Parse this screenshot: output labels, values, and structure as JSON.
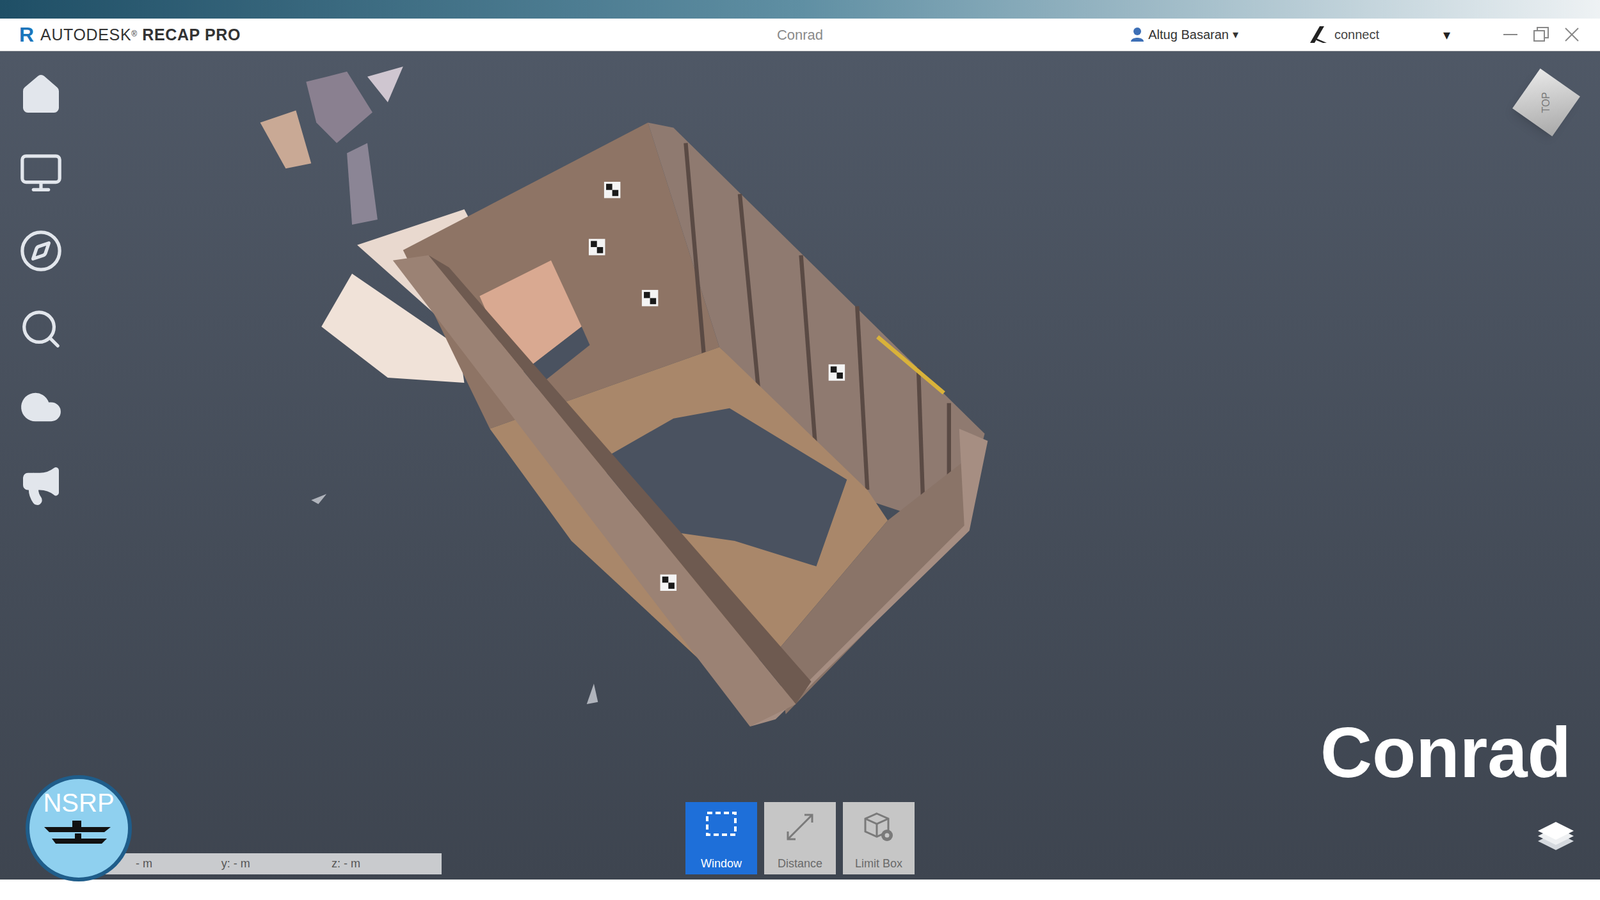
{
  "app": {
    "logo_letter": "R",
    "brand": "AUTODESK",
    "brand_mark": "®",
    "product": "RECAP PRO"
  },
  "window": {
    "title": "Conrad"
  },
  "account": {
    "user": "Altug Basaran",
    "user_caret": "▾",
    "service": "connect",
    "service_caret": "▾"
  },
  "view_cube": {
    "label": "TOP"
  },
  "tools": [
    {
      "label": "Window",
      "selected": true
    },
    {
      "label": "Distance",
      "selected": false
    },
    {
      "label": "Limit Box",
      "selected": false
    }
  ],
  "coordinates": [
    "- m",
    "y: - m",
    "z: - m"
  ],
  "caption": "Conrad",
  "badge": {
    "text": "NSRP"
  }
}
